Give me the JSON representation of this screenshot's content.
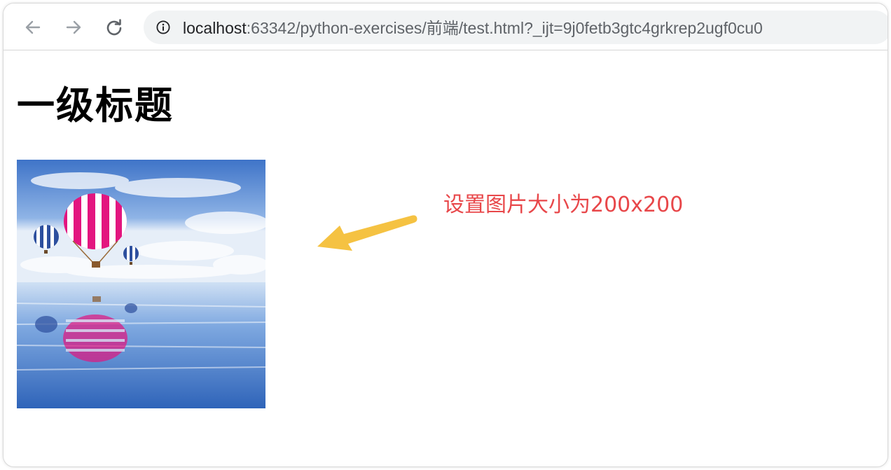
{
  "browser": {
    "back_icon": "arrow-left-icon",
    "forward_icon": "arrow-right-icon",
    "reload_icon": "reload-icon",
    "info_icon": "info-icon",
    "address": {
      "host": "localhost",
      "rest": ":63342/python-exercises/前端/test.html?_ijt=9j0fetb3gtc4grkrep2ugf0cu0"
    }
  },
  "page": {
    "heading": "一级标题",
    "image_alt": "",
    "annotation": "设置图片大小为200x200"
  },
  "colors": {
    "annotation": "#e8474a",
    "arrow": "#f5c242",
    "address_bar_bg": "#f1f3f4"
  }
}
